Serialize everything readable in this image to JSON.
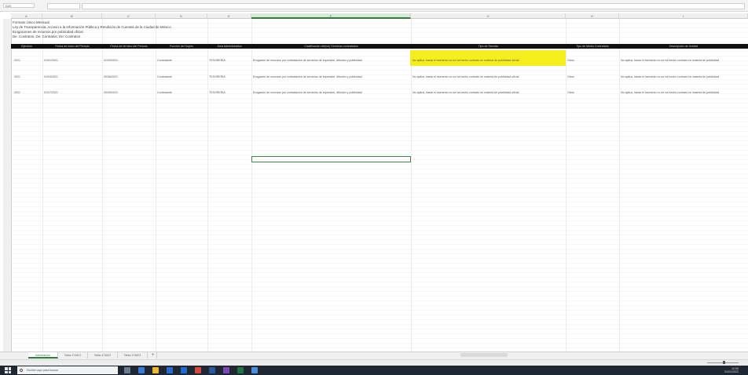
{
  "window": {
    "name_box": "D20"
  },
  "info_lines": [
    "Formato Único Mensual",
    "Ley de Transparencia, Acceso a la Información Pública y Rendición de Cuentas de la Ciudad de México",
    "Erogaciones de recursos por publicidad oficial",
    "De: Contratos; De: Contratos; De: Contratos"
  ],
  "columns": [
    "A",
    "B",
    "C",
    "D",
    "E",
    "F",
    "G",
    "H",
    "I",
    "J"
  ],
  "table": {
    "headers": [
      "Ejercicio",
      "Fecha de inicio del Periodo",
      "Fecha de término del Periodo",
      "Función del Sujeto",
      "Área Administrativa",
      "Clasificación del(los) Servicios contratados",
      "Tipo de Servicio",
      "Tipo de Medio Contratado",
      "Descripción de Unidad"
    ],
    "rows": [
      [
        "2021",
        "01/01/2021",
        "31/03/2021",
        "Contratante",
        "TESORERÍA",
        "Erogación de recursos por contratación de servicios de impresión, difusión y publicidad",
        "No aplica, hasta el momento no se ha hecho contrato en materia de publicidad oficial",
        "Otros",
        "No aplica, hasta el momento no se ha hecho contrato en materia de publicidad"
      ],
      [
        "2021",
        "01/04/2021",
        "30/06/2021",
        "Contratante",
        "TESORERÍA",
        "Erogación de recursos por contratación de servicios de impresión, difusión y publicidad",
        "No aplica, hasta el momento no se ha hecho contrato en materia de publicidad oficial",
        "Otros",
        "No aplica, hasta el momento no se ha hecho contrato en materia de publicidad"
      ],
      [
        "2021",
        "01/07/2021",
        "30/09/2021",
        "Contratante",
        "TESORERÍA",
        "Erogación de recursos por contratación de servicios de impresión, difusión y publicidad",
        "No aplica, hasta el momento no se ha hecho contrato en materia de publicidad oficial",
        "Otros",
        "No aplica, hasta el momento no se ha hecho contrato en materia de publicidad"
      ]
    ]
  },
  "sheet_tabs": [
    "Informacion",
    "Tabla 474821",
    "Tabla 474822",
    "Tabla 474823"
  ],
  "taskbar": {
    "search_placeholder": "Escribe aquí para buscar",
    "time": "12:00",
    "date": "01/01/2022"
  },
  "colors": {
    "highlight": "#f5ee1e",
    "accent": "#2f7d3a",
    "header_bg": "#111111"
  }
}
